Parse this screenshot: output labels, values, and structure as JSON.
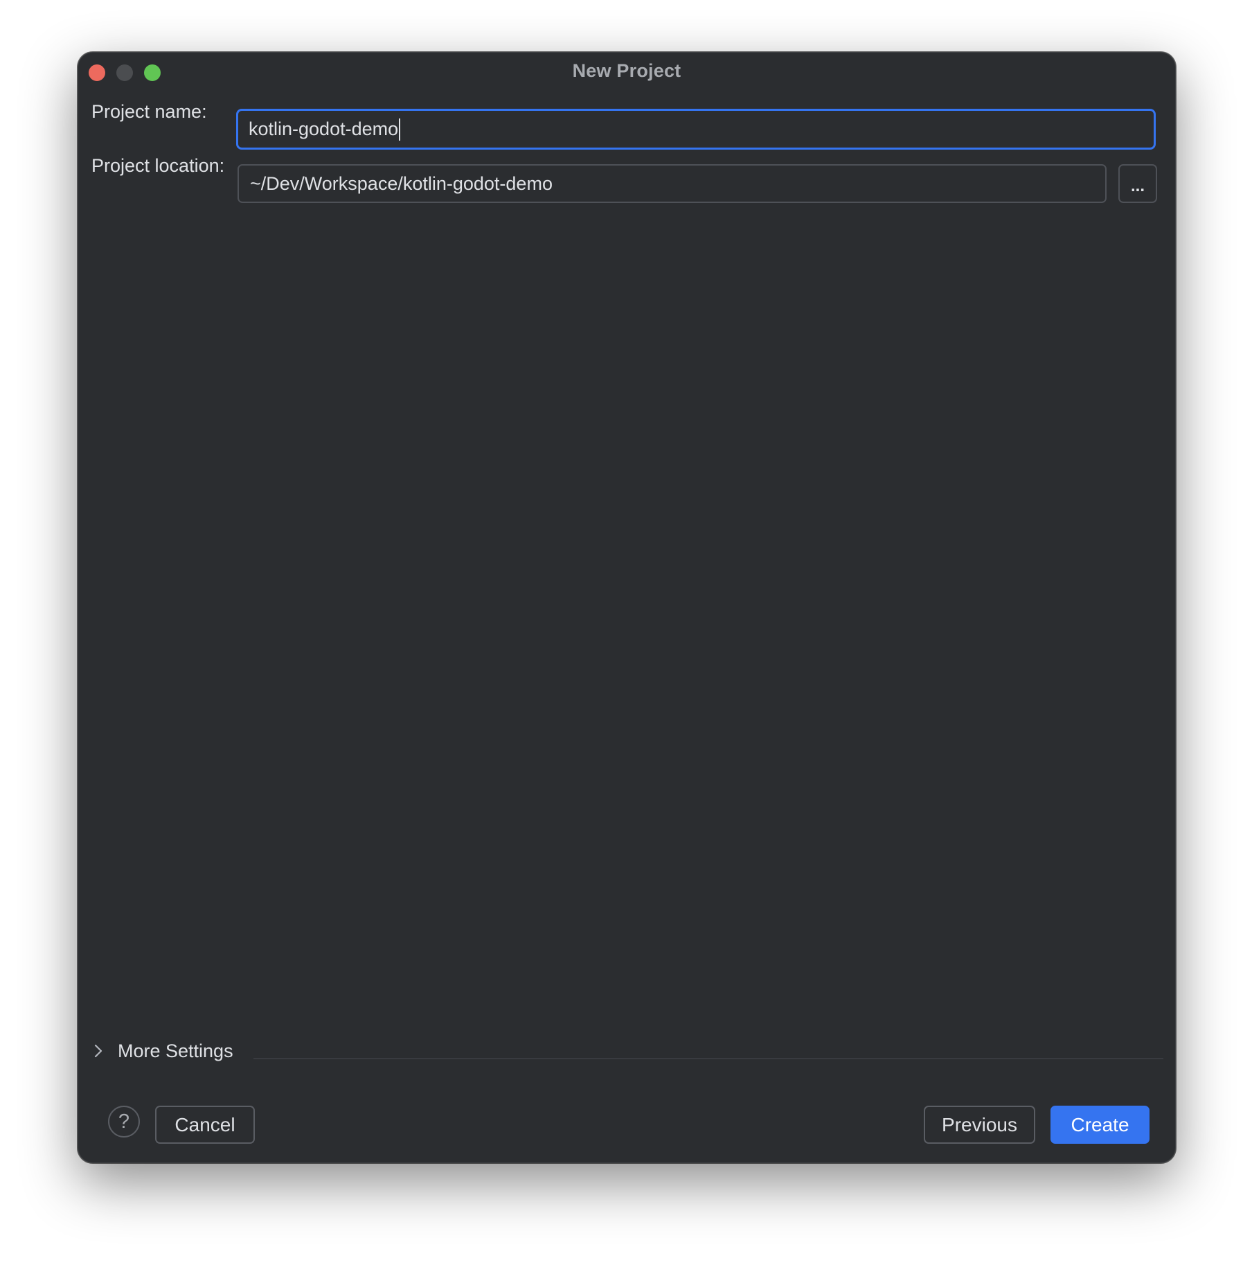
{
  "window": {
    "title": "New Project"
  },
  "form": {
    "project_name_label": "Project name:",
    "project_name_value": "kotlin-godot-demo",
    "project_location_label": "Project location:",
    "project_location_value": "~/Dev/Workspace/kotlin-godot-demo",
    "browse_label": "..."
  },
  "more_settings": {
    "label": "More Settings",
    "icon": "chevron-right-icon"
  },
  "footer": {
    "help_label": "?",
    "cancel_label": "Cancel",
    "previous_label": "Previous",
    "create_label": "Create"
  },
  "colors": {
    "window_background": "#2b2d30",
    "accent": "#3574f0",
    "close": "#ed6a5e",
    "minimize": "#4b4d50",
    "zoom": "#61c554"
  }
}
